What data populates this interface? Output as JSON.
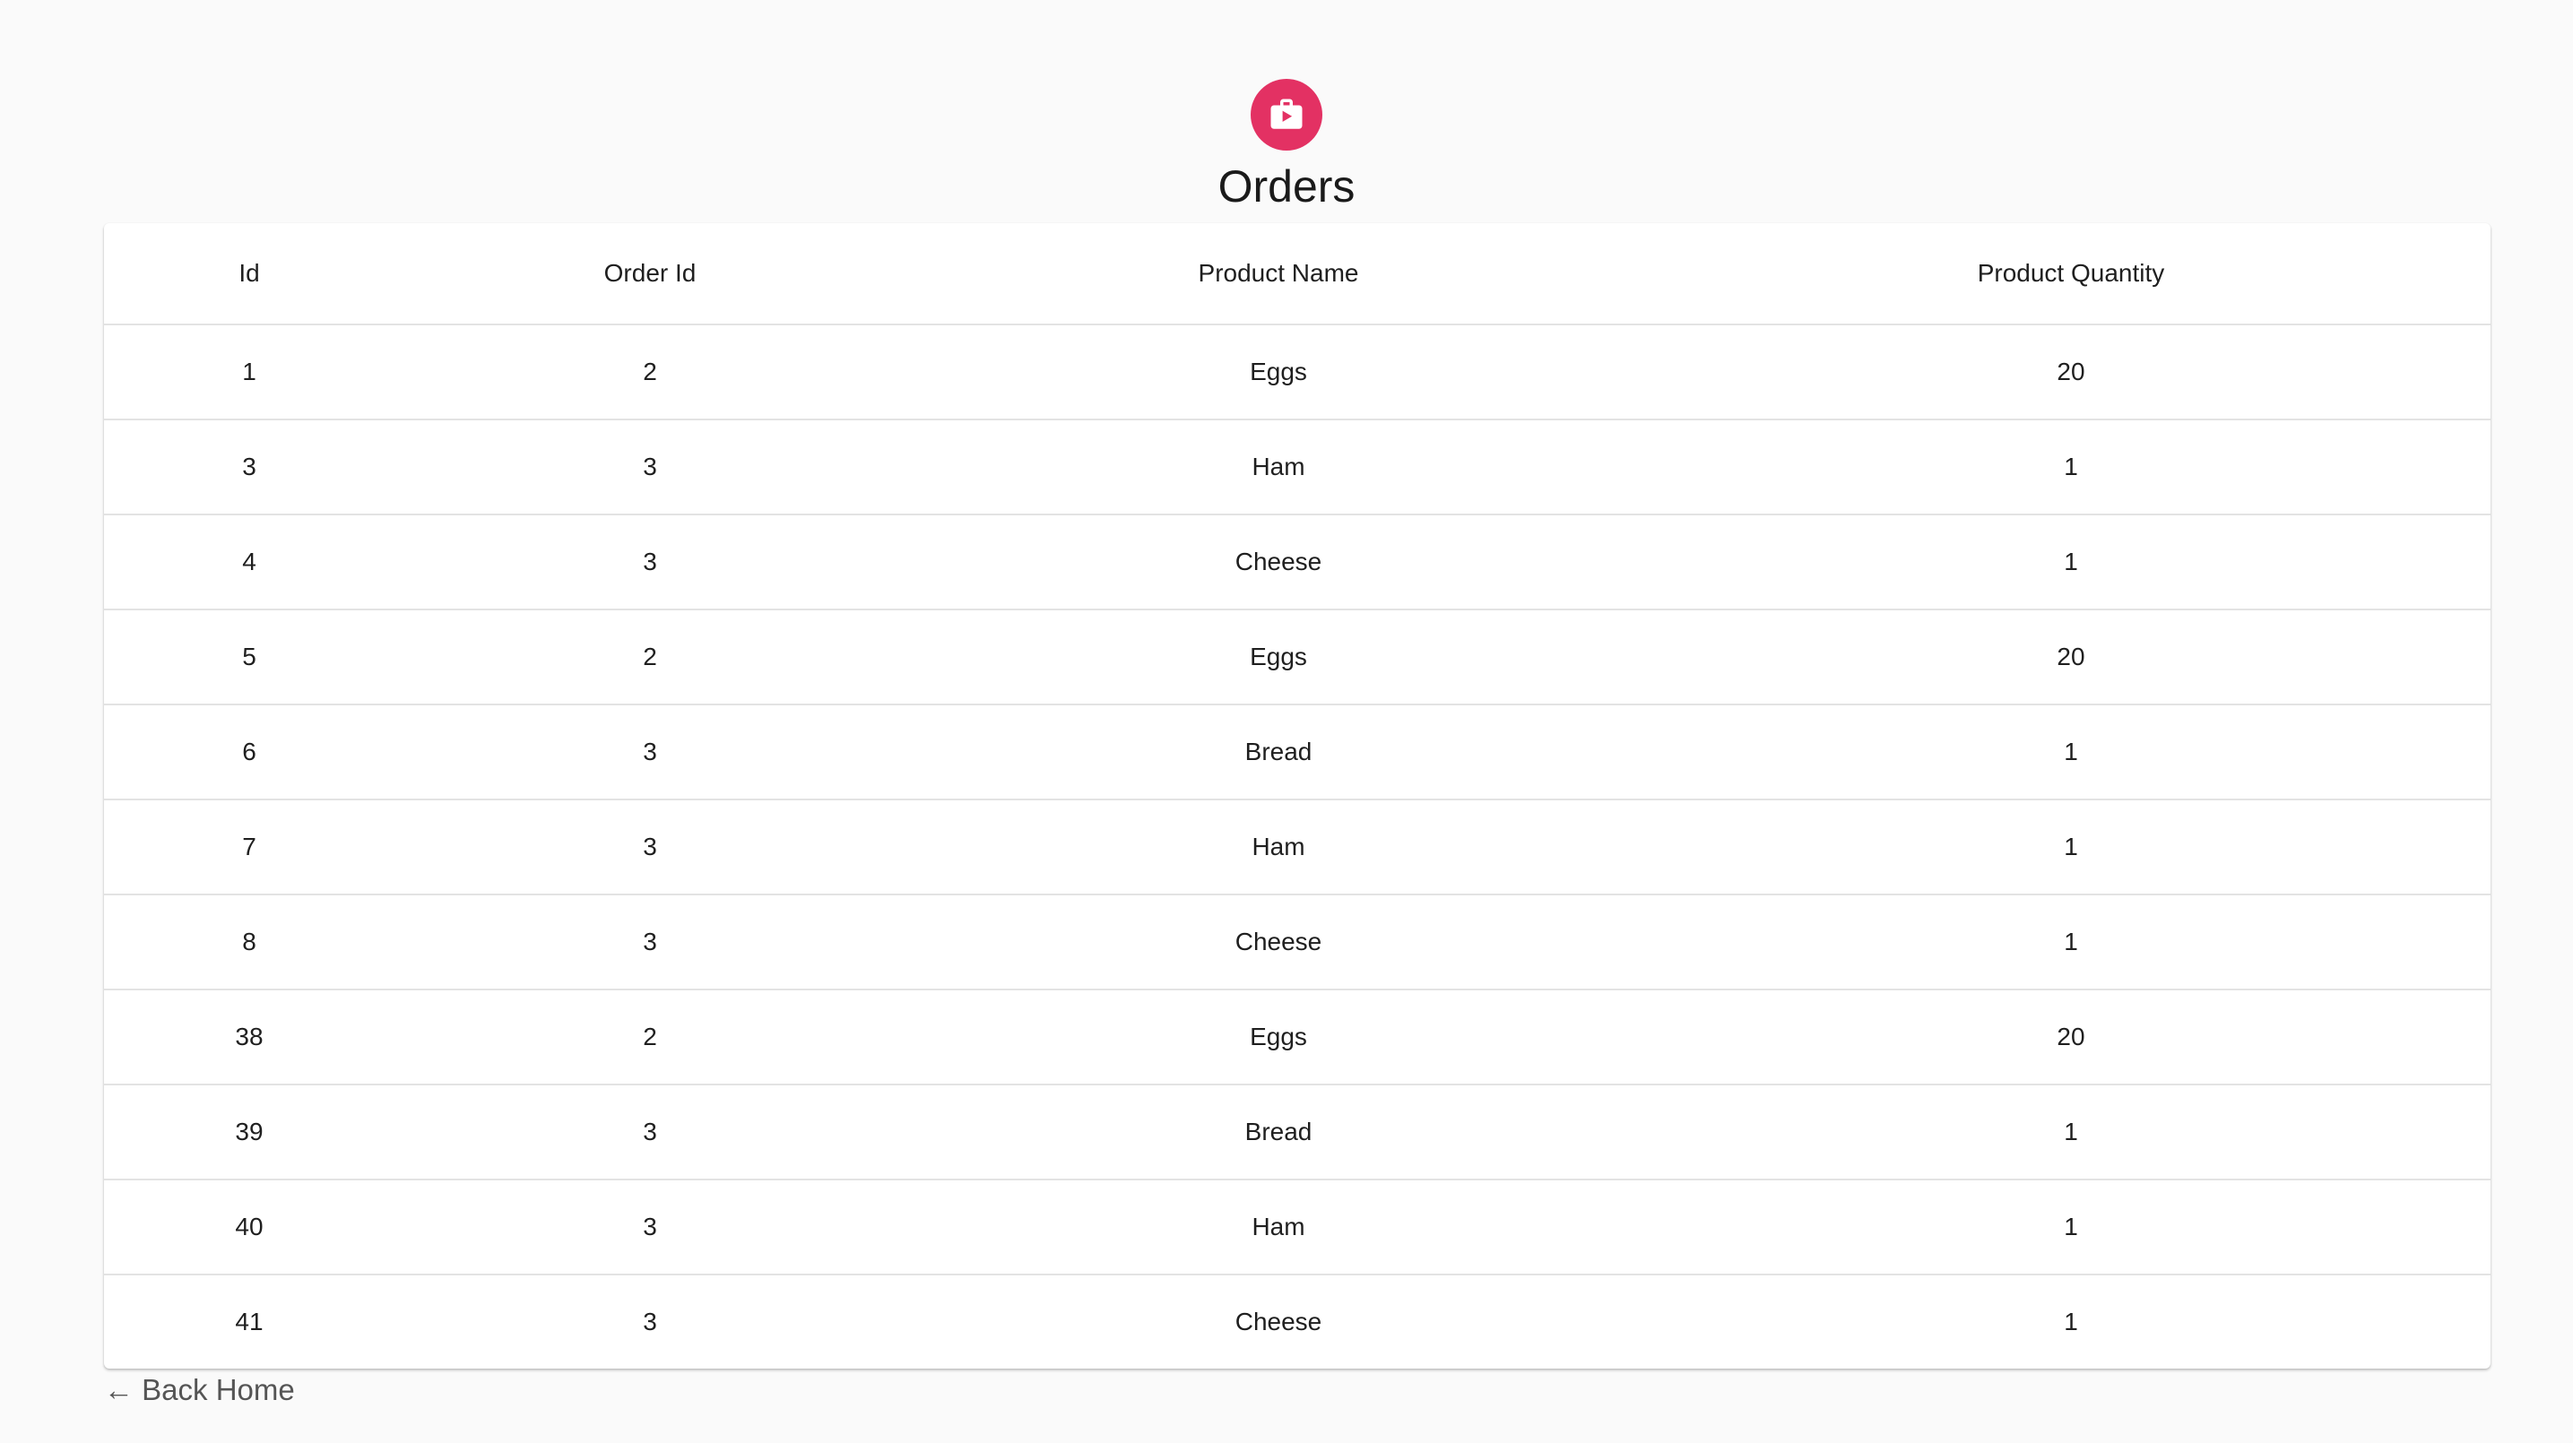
{
  "header": {
    "title": "Orders",
    "icon": "shopping-bag-icon",
    "accent_color": "#e33163"
  },
  "table": {
    "columns": [
      "Id",
      "Order Id",
      "Product Name",
      "Product Quantity"
    ],
    "rows": [
      [
        "1",
        "2",
        "Eggs",
        "20"
      ],
      [
        "3",
        "3",
        "Ham",
        "1"
      ],
      [
        "4",
        "3",
        "Cheese",
        "1"
      ],
      [
        "5",
        "2",
        "Eggs",
        "20"
      ],
      [
        "6",
        "3",
        "Bread",
        "1"
      ],
      [
        "7",
        "3",
        "Ham",
        "1"
      ],
      [
        "8",
        "3",
        "Cheese",
        "1"
      ],
      [
        "38",
        "2",
        "Eggs",
        "20"
      ],
      [
        "39",
        "3",
        "Bread",
        "1"
      ],
      [
        "40",
        "3",
        "Ham",
        "1"
      ],
      [
        "41",
        "3",
        "Cheese",
        "1"
      ]
    ]
  },
  "footer": {
    "back_label": "← Back Home"
  }
}
